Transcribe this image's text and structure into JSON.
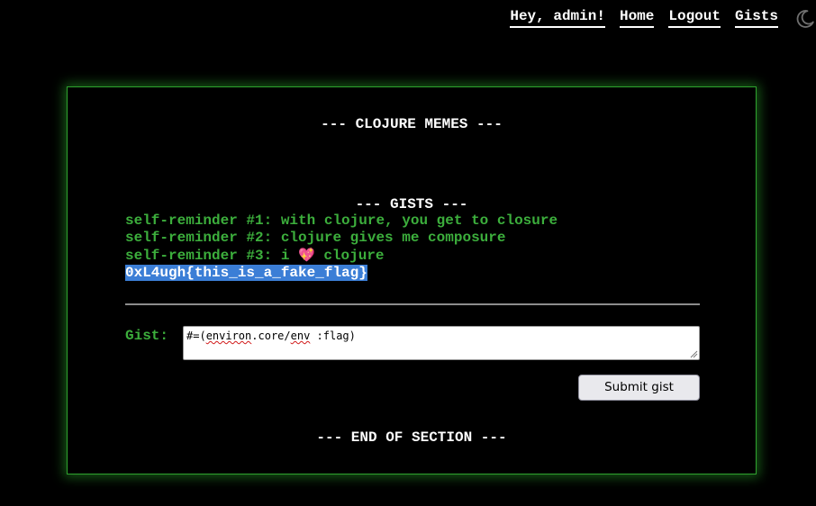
{
  "nav": {
    "greeting": "Hey, admin!",
    "home": "Home",
    "logout": "Logout",
    "gists": "Gists",
    "theme_icon": "moon-icon"
  },
  "panel": {
    "title": "--- CLOJURE MEMES ---",
    "gists_title": "--- GISTS ---",
    "end_title": "--- END OF SECTION ---",
    "gists": [
      {
        "before": "self-reminder #1: with clojure, you get to closure"
      },
      {
        "before": "self-reminder #2: clojure gives me composure"
      },
      {
        "before": "self-reminder #3: i ",
        "emoji": "💖",
        "after": " clojure"
      },
      {
        "before": "0xL4ugh{this_is_a_fake_flag}"
      }
    ],
    "form": {
      "label": "Gist:",
      "value_part1": "#=(",
      "value_squiggle1": "environ",
      "value_part2": ".core/",
      "value_squiggle2": "env",
      "value_part3": " :flag)",
      "submit_label": "Submit gist"
    }
  },
  "colors": {
    "background": "#000000",
    "accent_green": "#3cae3c",
    "border_green": "#2fa32f",
    "selection_blue": "#3b7ed6",
    "text_white": "#ffffff"
  }
}
